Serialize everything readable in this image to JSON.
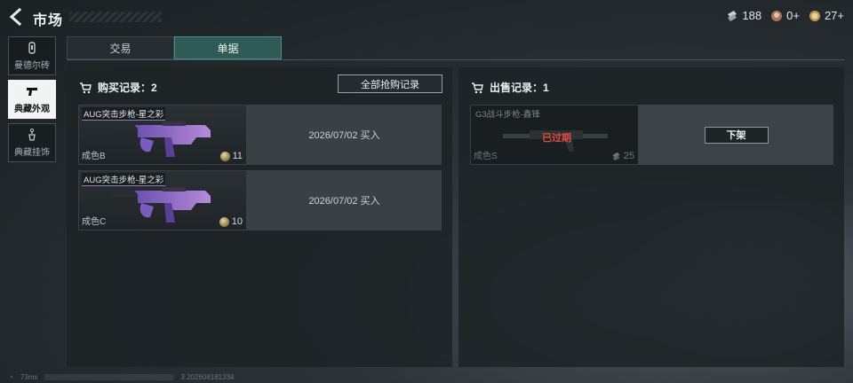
{
  "header": {
    "title": "市场"
  },
  "currencies": [
    {
      "icon": "ticket-icon",
      "value": "188"
    },
    {
      "icon": "coin-face-icon",
      "value": "0+"
    },
    {
      "icon": "gold-coin-icon",
      "value": "27+"
    }
  ],
  "sidebar": {
    "items": [
      {
        "label": "曼德尔砖",
        "icon": "brick-icon",
        "active": false
      },
      {
        "label": "典藏外观",
        "icon": "pistol-icon",
        "active": true
      },
      {
        "label": "典藏挂饰",
        "icon": "charm-icon",
        "active": false
      }
    ]
  },
  "tabs": [
    {
      "label": "交易",
      "active": false
    },
    {
      "label": "单据",
      "active": true
    }
  ],
  "purchase": {
    "title": "购买记录：2",
    "all_button": "全部抢购记录",
    "records": [
      {
        "weapon": "AUG突击步枪-星之彩",
        "quality": "成色B",
        "price": "11",
        "info": "2026/07/02 买入"
      },
      {
        "weapon": "AUG突击步枪-星之彩",
        "quality": "成色C",
        "price": "10",
        "info": "2026/07/02 买入"
      }
    ]
  },
  "sales": {
    "title": "出售记录：1",
    "records": [
      {
        "weapon": "G3战斗步枪-鑫锋",
        "quality": "成色S",
        "price": "25",
        "status": "已过期",
        "action": "下架"
      }
    ]
  },
  "footer": {
    "ping": "73ms",
    "build": "3.202608181334"
  }
}
